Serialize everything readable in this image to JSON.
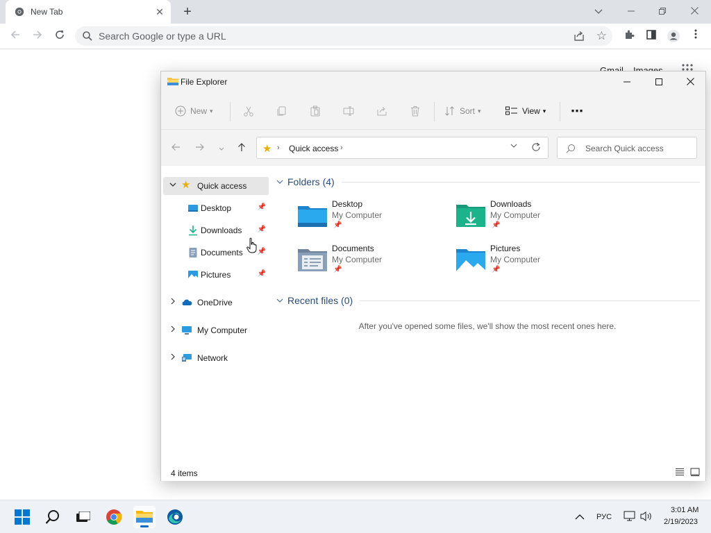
{
  "browser": {
    "tab_title": "New Tab",
    "tab_close": "✕",
    "new_tab": "+",
    "omnibox_placeholder": "Search Google or type a URL",
    "ntp_gmail": "Gmail",
    "ntp_images": "Images"
  },
  "explorer": {
    "title": "File Explorer",
    "commands": {
      "new": "New",
      "sort": "Sort",
      "view": "View",
      "more": "⋯"
    },
    "address": {
      "location": "Quick access",
      "separator": "›"
    },
    "search_placeholder": "Search Quick access",
    "sidebar": [
      {
        "label": "Quick access",
        "icon": "star-icon",
        "expanded": true,
        "selected": true
      },
      {
        "label": "Desktop",
        "icon": "desktop-folder-icon",
        "pinned": true
      },
      {
        "label": "Downloads",
        "icon": "downloads-folder-icon",
        "pinned": true
      },
      {
        "label": "Documents",
        "icon": "documents-folder-icon",
        "pinned": true
      },
      {
        "label": "Pictures",
        "icon": "pictures-folder-icon",
        "pinned": true
      },
      {
        "label": "OneDrive",
        "icon": "onedrive-icon",
        "expanded": false
      },
      {
        "label": "My Computer",
        "icon": "computer-icon",
        "expanded": false
      },
      {
        "label": "Network",
        "icon": "network-icon",
        "expanded": false
      }
    ],
    "folders_header": "Folders (4)",
    "folders": [
      {
        "name": "Desktop",
        "location": "My Computer",
        "icon": "desktop-folder-icon"
      },
      {
        "name": "Downloads",
        "location": "My Computer",
        "icon": "downloads-folder-icon"
      },
      {
        "name": "Documents",
        "location": "My Computer",
        "icon": "documents-folder-icon"
      },
      {
        "name": "Pictures",
        "location": "My Computer",
        "icon": "pictures-folder-icon"
      }
    ],
    "recent_header": "Recent files (0)",
    "recent_empty": "After you've opened some files, we'll show the most recent ones here.",
    "status": "4 items"
  },
  "taskbar": {
    "language": "РУС",
    "time": "3:01 AM",
    "date": "2/19/2023"
  },
  "colors": {
    "accent": "#0067c0",
    "star": "#e8b000",
    "folder_blue": "#2a9be0",
    "downloads_green": "#1bb38a"
  }
}
